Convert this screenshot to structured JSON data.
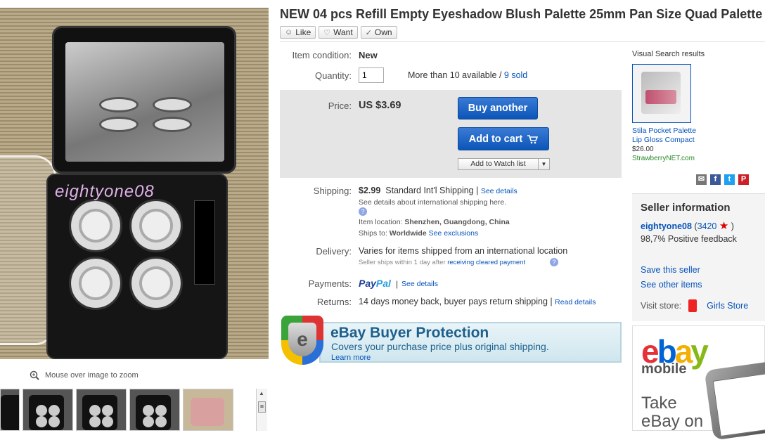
{
  "main_image": {
    "watermark": "eightyone08"
  },
  "zoom_hint": "Mouse over image to zoom",
  "title": "NEW 04 pcs Refill Empty Eyeshadow Blush Palette 25mm Pan Size Quad Palette",
  "social": {
    "like": "Like",
    "want": "Want",
    "own": "Own"
  },
  "condition": {
    "label": "Item condition:",
    "value": "New"
  },
  "quantity": {
    "label": "Quantity:",
    "value": "1",
    "available": "More than 10 available / ",
    "sold": "9 sold"
  },
  "price": {
    "label": "Price:",
    "value": "US $3.69"
  },
  "buttons": {
    "buy": "Buy another",
    "cart": "Add to cart",
    "watch": "Add to Watch list"
  },
  "shipping": {
    "label": "Shipping:",
    "cost": "$2.99",
    "service": "Standard Int'l Shipping | ",
    "details_link": "See details",
    "intl_note": "See details about international shipping here.",
    "location_label": "Item location: ",
    "location": "Shenzhen, Guangdong, China",
    "ships_to_label": "Ships to: ",
    "ships_to": "Worldwide",
    "exclusions_link": "See exclusions"
  },
  "delivery": {
    "label": "Delivery:",
    "value": "Varies for items shipped from an international location",
    "sub": "Seller ships within 1 day after ",
    "sub_link": "receiving cleared payment"
  },
  "payments": {
    "label": "Payments:",
    "pay1": "Pay",
    "pay2": "Pal",
    "separator": "|",
    "link": "See details"
  },
  "returns": {
    "label": "Returns:",
    "value": "14 days money back, buyer pays return shipping | ",
    "link": "Read details"
  },
  "protection": {
    "title": "eBay Buyer Protection",
    "subtitle": "Covers your purchase price plus original shipping.",
    "link": "Learn more"
  },
  "visual_search": {
    "title": "Visual Search results",
    "name_line1": "Stila Pocket Palette",
    "name_line2": "Lip Gloss Compact",
    "price": "$26.00",
    "store": "StrawberryNET.com"
  },
  "seller": {
    "title": "Seller information",
    "name": "eightyone08",
    "score_open": " (",
    "score": "3420",
    "score_close": " )",
    "feedback": "98,7% Positive feedback",
    "save": "Save this seller",
    "other": "See other items",
    "visit_label": "Visit store:",
    "store": "Girls Store"
  },
  "ad": {
    "logo_e": "e",
    "logo_b": "b",
    "logo_a": "a",
    "logo_y": "y",
    "mobile": "mobile",
    "take_line1": "Take",
    "take_line2": "eBay on"
  },
  "colors": {
    "link": "#0654ba",
    "button": "#0b55b8",
    "price_box": "#e5e5e5"
  }
}
